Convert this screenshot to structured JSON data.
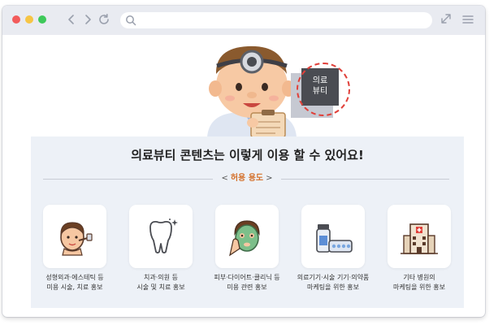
{
  "browser": {
    "controls": [
      "close",
      "minimize",
      "maximize"
    ],
    "icons": [
      "back-arrow-icon",
      "forward-arrow-icon",
      "reload-icon",
      "search-icon",
      "expand-icon",
      "hamburger-menu-icon"
    ],
    "address_value": ""
  },
  "hero": {
    "tag_line1": "의료",
    "tag_line2": "뷰티"
  },
  "panel": {
    "headline": "의료뷰티 콘텐츠는 이렇게 이용 할 수 있어요!",
    "subtitle_left": "<",
    "subtitle": "허용 용도",
    "subtitle_right": ">"
  },
  "uses": [
    {
      "icon": "face-surgery-icon",
      "line1": "성형외과·에스테틱 등",
      "line2": "미용 시술, 치료 홍보"
    },
    {
      "icon": "tooth-icon",
      "line1": "치과·의원 등",
      "line2": "시술 및 치료 홍보"
    },
    {
      "icon": "face-mask-icon",
      "line1": "피부·다이어트·클리닉 등",
      "line2": "미용 관련 홍보"
    },
    {
      "icon": "medical-supplies-icon",
      "line1": "의료기기·시술 기기·의약품",
      "line2": "마케팅을 위한 홍보"
    },
    {
      "icon": "hospital-building-icon",
      "line1": "기타 병원의",
      "line2": "마케팅을 위한 홍보"
    }
  ],
  "colors": {
    "accent_orange": "#d4702a",
    "panel_bg": "#edf1f7",
    "tag_bg": "#4a4c52",
    "ring_red": "#e0403a"
  }
}
